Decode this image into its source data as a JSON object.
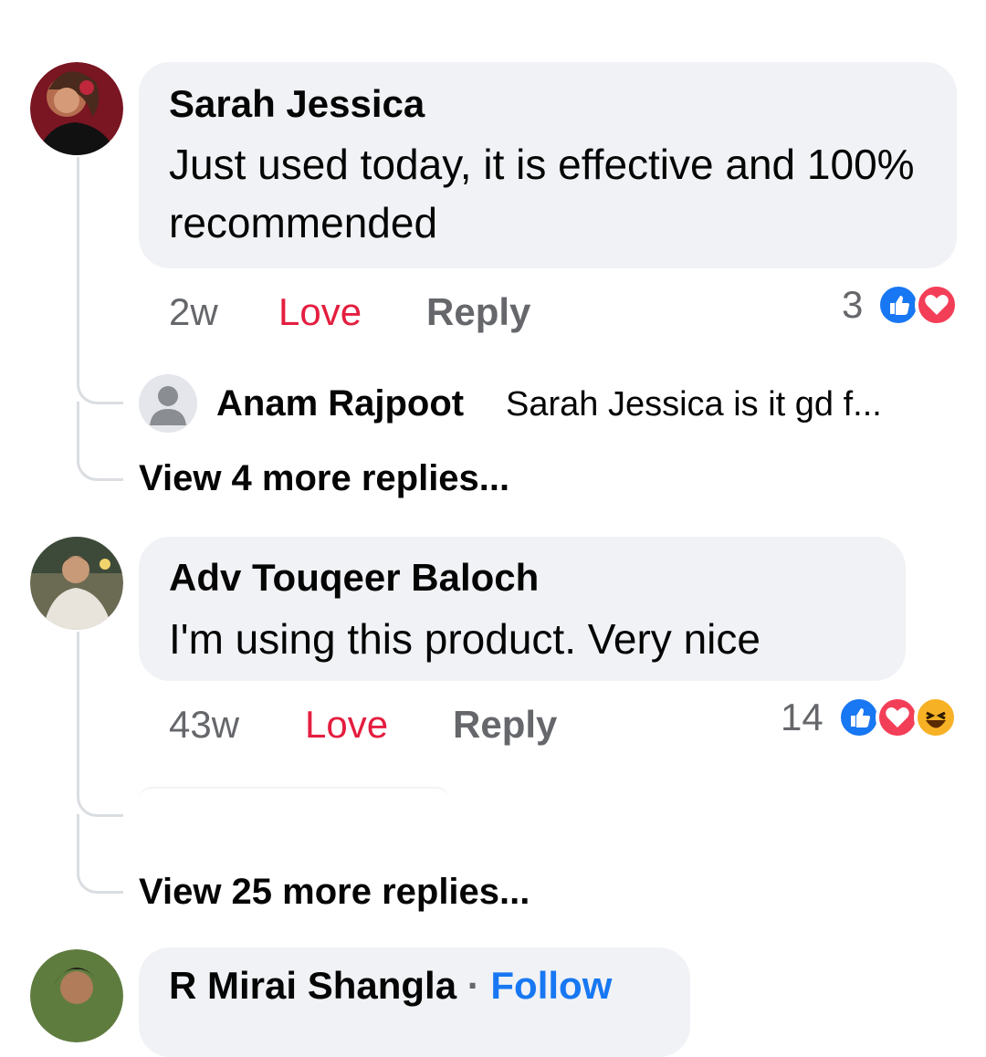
{
  "comments": [
    {
      "author": "Sarah Jessica",
      "text": "Just used today, it is effective and 100% recommended",
      "time": "2w",
      "love_label": "Love",
      "reply_label": "Reply",
      "reaction_count": "3",
      "reactions": [
        "like-icon",
        "love-icon"
      ],
      "replies": [
        {
          "author": "Anam Rajpoot",
          "text": "Sarah Jessica is it gd f..."
        }
      ],
      "view_more": "View 4 more replies..."
    },
    {
      "author": "Adv Touqeer Baloch",
      "text": "I'm using this product. Very nice",
      "time": "43w",
      "love_label": "Love",
      "reply_label": "Reply",
      "reaction_count": "14",
      "reactions": [
        "like-icon",
        "love-icon",
        "haha-icon"
      ],
      "view_more": "View 25 more replies..."
    },
    {
      "author": "R Mirai Shangla",
      "follow_label": "Follow"
    }
  ],
  "colors": {
    "bubble": "#f0f2f5",
    "love": "#e41e3f",
    "like": "#1877f2",
    "secondary_text": "#65676b",
    "thread_line": "#dadde1"
  }
}
